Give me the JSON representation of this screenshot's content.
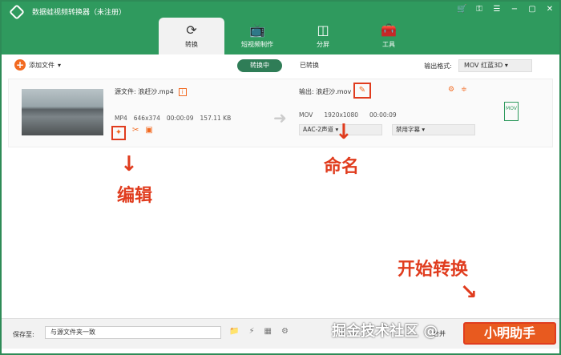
{
  "window": {
    "title": "数据蛙视频转换器（未注册）"
  },
  "tabs": [
    {
      "label": "转换",
      "icon": "convert-icon",
      "active": true
    },
    {
      "label": "短视频制作",
      "icon": "tv-icon"
    },
    {
      "label": "分屏",
      "icon": "split-screen-icon"
    },
    {
      "label": "工具",
      "icon": "toolbox-icon"
    }
  ],
  "toolbar": {
    "add_file": "添加文件",
    "converting": "转换中",
    "converted": "已转换",
    "output_format_label": "输出格式:",
    "output_format_value": "MOV 红蓝3D"
  },
  "file": {
    "source_label": "源文件: 浪赶沙.mp4",
    "format": "MP4",
    "resolution": "646x374",
    "duration": "00:00:09",
    "size": "157.11 KB",
    "output_label": "输出: 浪赶沙.mov",
    "out_format": "MOV",
    "out_resolution": "1920x1080",
    "out_duration": "00:00:09",
    "audio": "AAC-2声道",
    "subtitle": "禁用字幕",
    "badge": "MOV"
  },
  "annotations": {
    "edit": "编辑",
    "rename": "命名",
    "start": "开始转换"
  },
  "bottom": {
    "save_to_label": "保存至:",
    "save_to_value": "与源文件夹一致",
    "merge_label": "合并",
    "start_button": "小明助手"
  },
  "watermark": "掘金技术社区 @",
  "colors": {
    "brand": "#2f9a5e",
    "accent": "#f26a21",
    "annotation": "#e03c1e"
  }
}
